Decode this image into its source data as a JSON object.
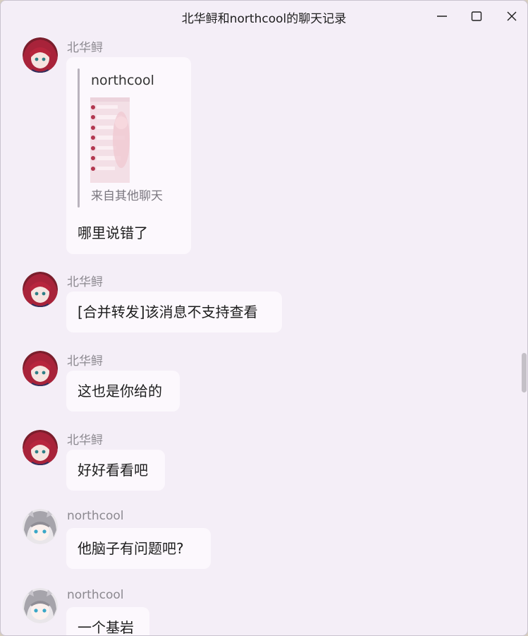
{
  "window": {
    "title": "北华鲟和northcool的聊天记录"
  },
  "messages": [
    {
      "sender": "北华鲟",
      "avatar": "red-hair-anime-avatar",
      "quote": {
        "name": "northcool",
        "source": "来自其他聊天"
      },
      "text": "哪里说错了"
    },
    {
      "sender": "北华鲟",
      "avatar": "red-hair-anime-avatar",
      "text": "[合并转发]该消息不支持查看"
    },
    {
      "sender": "北华鲟",
      "avatar": "red-hair-anime-avatar",
      "text": "这也是你给的"
    },
    {
      "sender": "北华鲟",
      "avatar": "red-hair-anime-avatar",
      "text": "好好看看吧"
    },
    {
      "sender": "northcool",
      "avatar": "gray-hair-anime-avatar",
      "text": "他脑子有问题吧?"
    },
    {
      "sender": "northcool",
      "avatar": "gray-hair-anime-avatar",
      "text": "一个基岩"
    }
  ],
  "colors": {
    "window_bg": "#f4eef7",
    "bubble_bg": "#fcf8fd",
    "sender_text": "#8c8990"
  }
}
